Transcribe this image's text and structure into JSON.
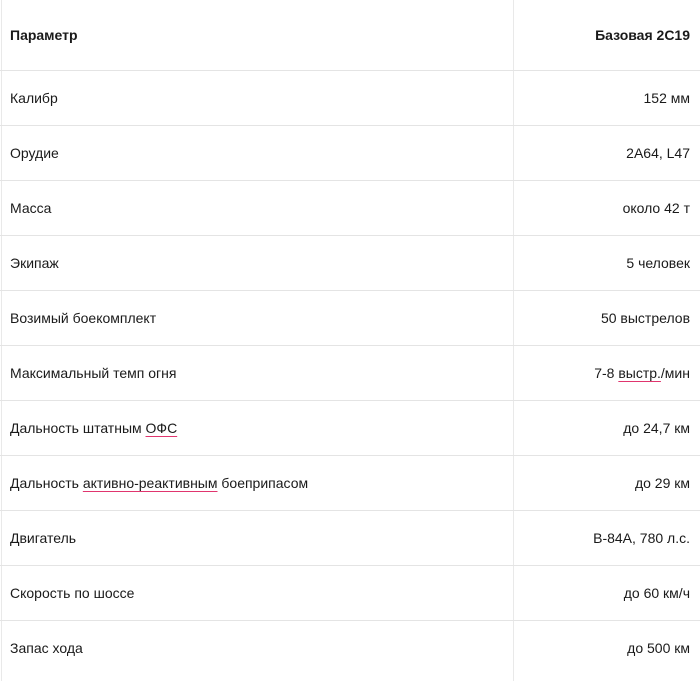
{
  "table": {
    "header": {
      "param": "Параметр",
      "value": "Базовая 2С19"
    },
    "rows": [
      {
        "param": [
          "Калибр"
        ],
        "value": [
          "152 мм"
        ]
      },
      {
        "param": [
          "Орудие"
        ],
        "value": [
          "2А64, L47"
        ]
      },
      {
        "param": [
          "Масса"
        ],
        "value": [
          "около 42 т"
        ]
      },
      {
        "param": [
          "Экипаж"
        ],
        "value": [
          "5 человек"
        ]
      },
      {
        "param": [
          "Возимый боекомплект"
        ],
        "value": [
          "50 выстрелов"
        ]
      },
      {
        "param": [
          "Максимальный темп огня"
        ],
        "value": [
          "7-8 ",
          "выстр.",
          "/мин"
        ]
      },
      {
        "param": [
          "Дальность штатным ",
          "ОФС"
        ],
        "value": [
          "до 24,7 км"
        ]
      },
      {
        "param": [
          "Дальность ",
          "активно-реактивным",
          " боеприпасом"
        ],
        "value": [
          "до 29 км"
        ]
      },
      {
        "param": [
          "Двигатель"
        ],
        "value": [
          "В-84А, 780 л.с."
        ]
      },
      {
        "param": [
          "Скорость по шоссе"
        ],
        "value": [
          "до 60 км/ч"
        ]
      },
      {
        "param": [
          "Запас хода"
        ],
        "value": [
          "до 500 км"
        ]
      }
    ]
  },
  "colors": {
    "spellcheck_underline": "#e0356e",
    "grid": "#e4e4e4"
  }
}
